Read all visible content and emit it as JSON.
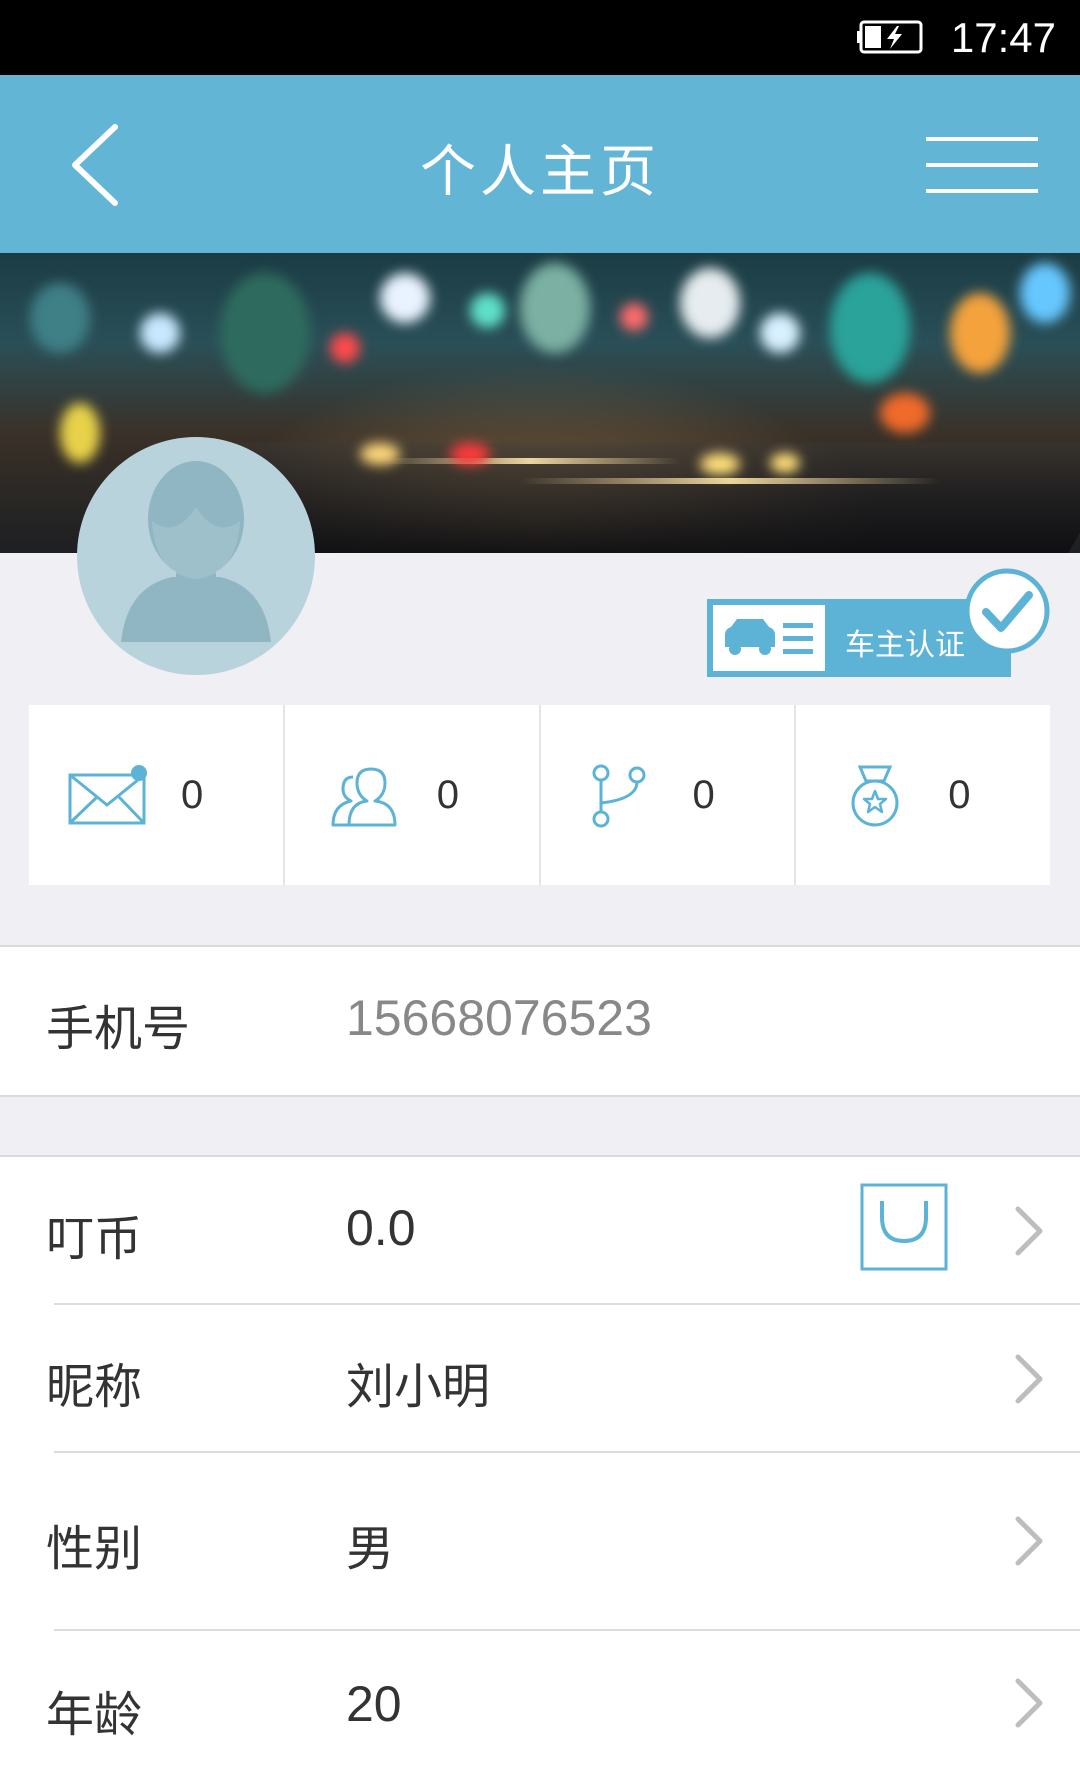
{
  "status_bar": {
    "time": "17:47"
  },
  "header": {
    "title": "个人主页"
  },
  "certification": {
    "label": "车主认证"
  },
  "stats": [
    {
      "icon": "mail-icon",
      "value": "0"
    },
    {
      "icon": "friends-icon",
      "value": "0"
    },
    {
      "icon": "route-icon",
      "value": "0"
    },
    {
      "icon": "medal-icon",
      "value": "0"
    }
  ],
  "phone": {
    "label": "手机号",
    "value": "15668076523"
  },
  "profile": {
    "coins": {
      "label": "叮币",
      "value": "0.0"
    },
    "nickname": {
      "label": "昵称",
      "value": "刘小明"
    },
    "gender": {
      "label": "性别",
      "value": "男"
    },
    "age": {
      "label": "年龄",
      "value": "20"
    }
  },
  "colors": {
    "accent": "#63b5d6",
    "badge": "#5db3d6",
    "avatar_bg": "#b9d3dc"
  }
}
